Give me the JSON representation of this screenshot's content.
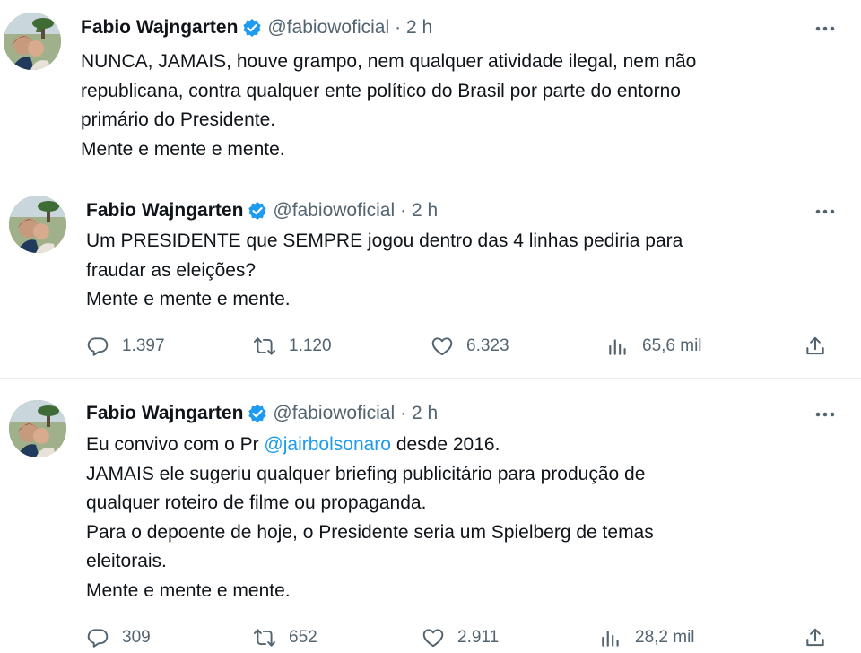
{
  "tweets": [
    {
      "author_name": "Fabio Wajngarten",
      "handle": "@fabiowoficial",
      "time": "· 2 h",
      "lines": [
        "NUNCA, JAMAIS, houve grampo, nem qualquer atividade ilegal, nem não",
        "republicana, contra qualquer ente político do Brasil por parte do entorno",
        "primário do Presidente.",
        "Mente e mente e mente."
      ]
    },
    {
      "author_name": "Fabio Wajngarten",
      "handle": "@fabiowoficial",
      "time": "· 2 h",
      "lines": [
        "Um PRESIDENTE que SEMPRE jogou dentro das 4 linhas pediria para",
        "fraudar as eleições?",
        "Mente e mente e mente."
      ],
      "stats": {
        "replies": "1.397",
        "retweets": "1.120",
        "likes": "6.323",
        "views": "65,6 mil"
      }
    },
    {
      "author_name": "Fabio Wajngarten",
      "handle": "@fabiowoficial",
      "time": "· 2 h",
      "first_line_pre": "Eu convivo com o Pr ",
      "mention": "@jairbolsonaro",
      "first_line_post": " desde 2016.",
      "lines": [
        "JAMAIS ele sugeriu qualquer briefing publicitário para produção de",
        "qualquer roteiro de filme ou propaganda.",
        "Para o depoente de hoje, o Presidente seria um Spielberg de temas",
        "eleitorais.",
        "Mente e mente e mente."
      ],
      "stats": {
        "replies": "309",
        "retweets": "652",
        "likes": "2.911",
        "views": "28,2 mil"
      }
    }
  ],
  "more_label": "···",
  "icons": {
    "reply": "reply-icon",
    "retweet": "retweet-icon",
    "like": "heart-icon",
    "views": "views-icon",
    "share": "share-icon",
    "verified": "verified-badge-icon"
  },
  "colors": {
    "text": "#0f1419",
    "secondary": "#536471",
    "link": "#1d9bf0",
    "verified": "#1d9bf0"
  }
}
